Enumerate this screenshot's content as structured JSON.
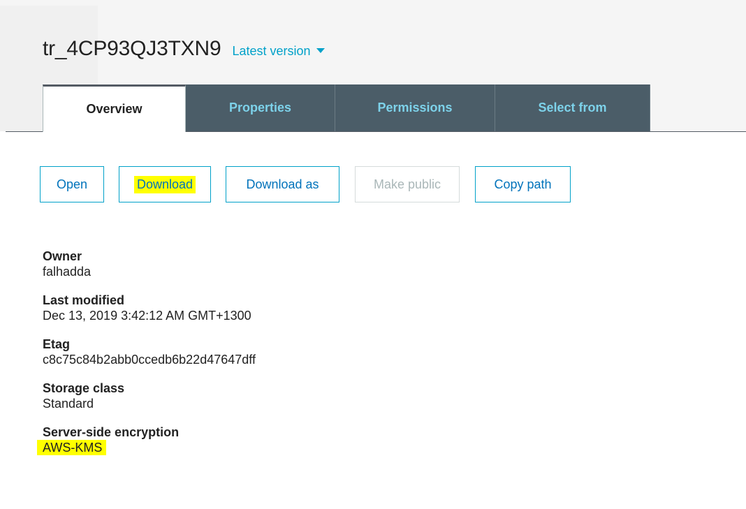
{
  "header": {
    "object_name": "tr_4CP93QJ3TXN9",
    "version_label": "Latest version"
  },
  "tabs": [
    {
      "label": "Overview",
      "active": true
    },
    {
      "label": "Properties",
      "active": false
    },
    {
      "label": "Permissions",
      "active": false
    },
    {
      "label": "Select from",
      "active": false
    }
  ],
  "actions": {
    "open": "Open",
    "download": "Download",
    "download_as": "Download as",
    "make_public": "Make public",
    "copy_path": "Copy path"
  },
  "details": {
    "owner": {
      "label": "Owner",
      "value": "falhadda"
    },
    "last_modified": {
      "label": "Last modified",
      "value": "Dec 13, 2019 3:42:12 AM GMT+1300"
    },
    "etag": {
      "label": "Etag",
      "value": "c8c75c84b2abb0ccedb6b22d47647dff"
    },
    "storage_class": {
      "label": "Storage class",
      "value": "Standard"
    },
    "encryption": {
      "label": "Server-side encryption",
      "value": "AWS-KMS"
    }
  },
  "colors": {
    "accent": "#00a1c9",
    "tab_bg": "#4b5d68",
    "tab_text": "#7dd2ea",
    "highlight": "#ffff00"
  }
}
